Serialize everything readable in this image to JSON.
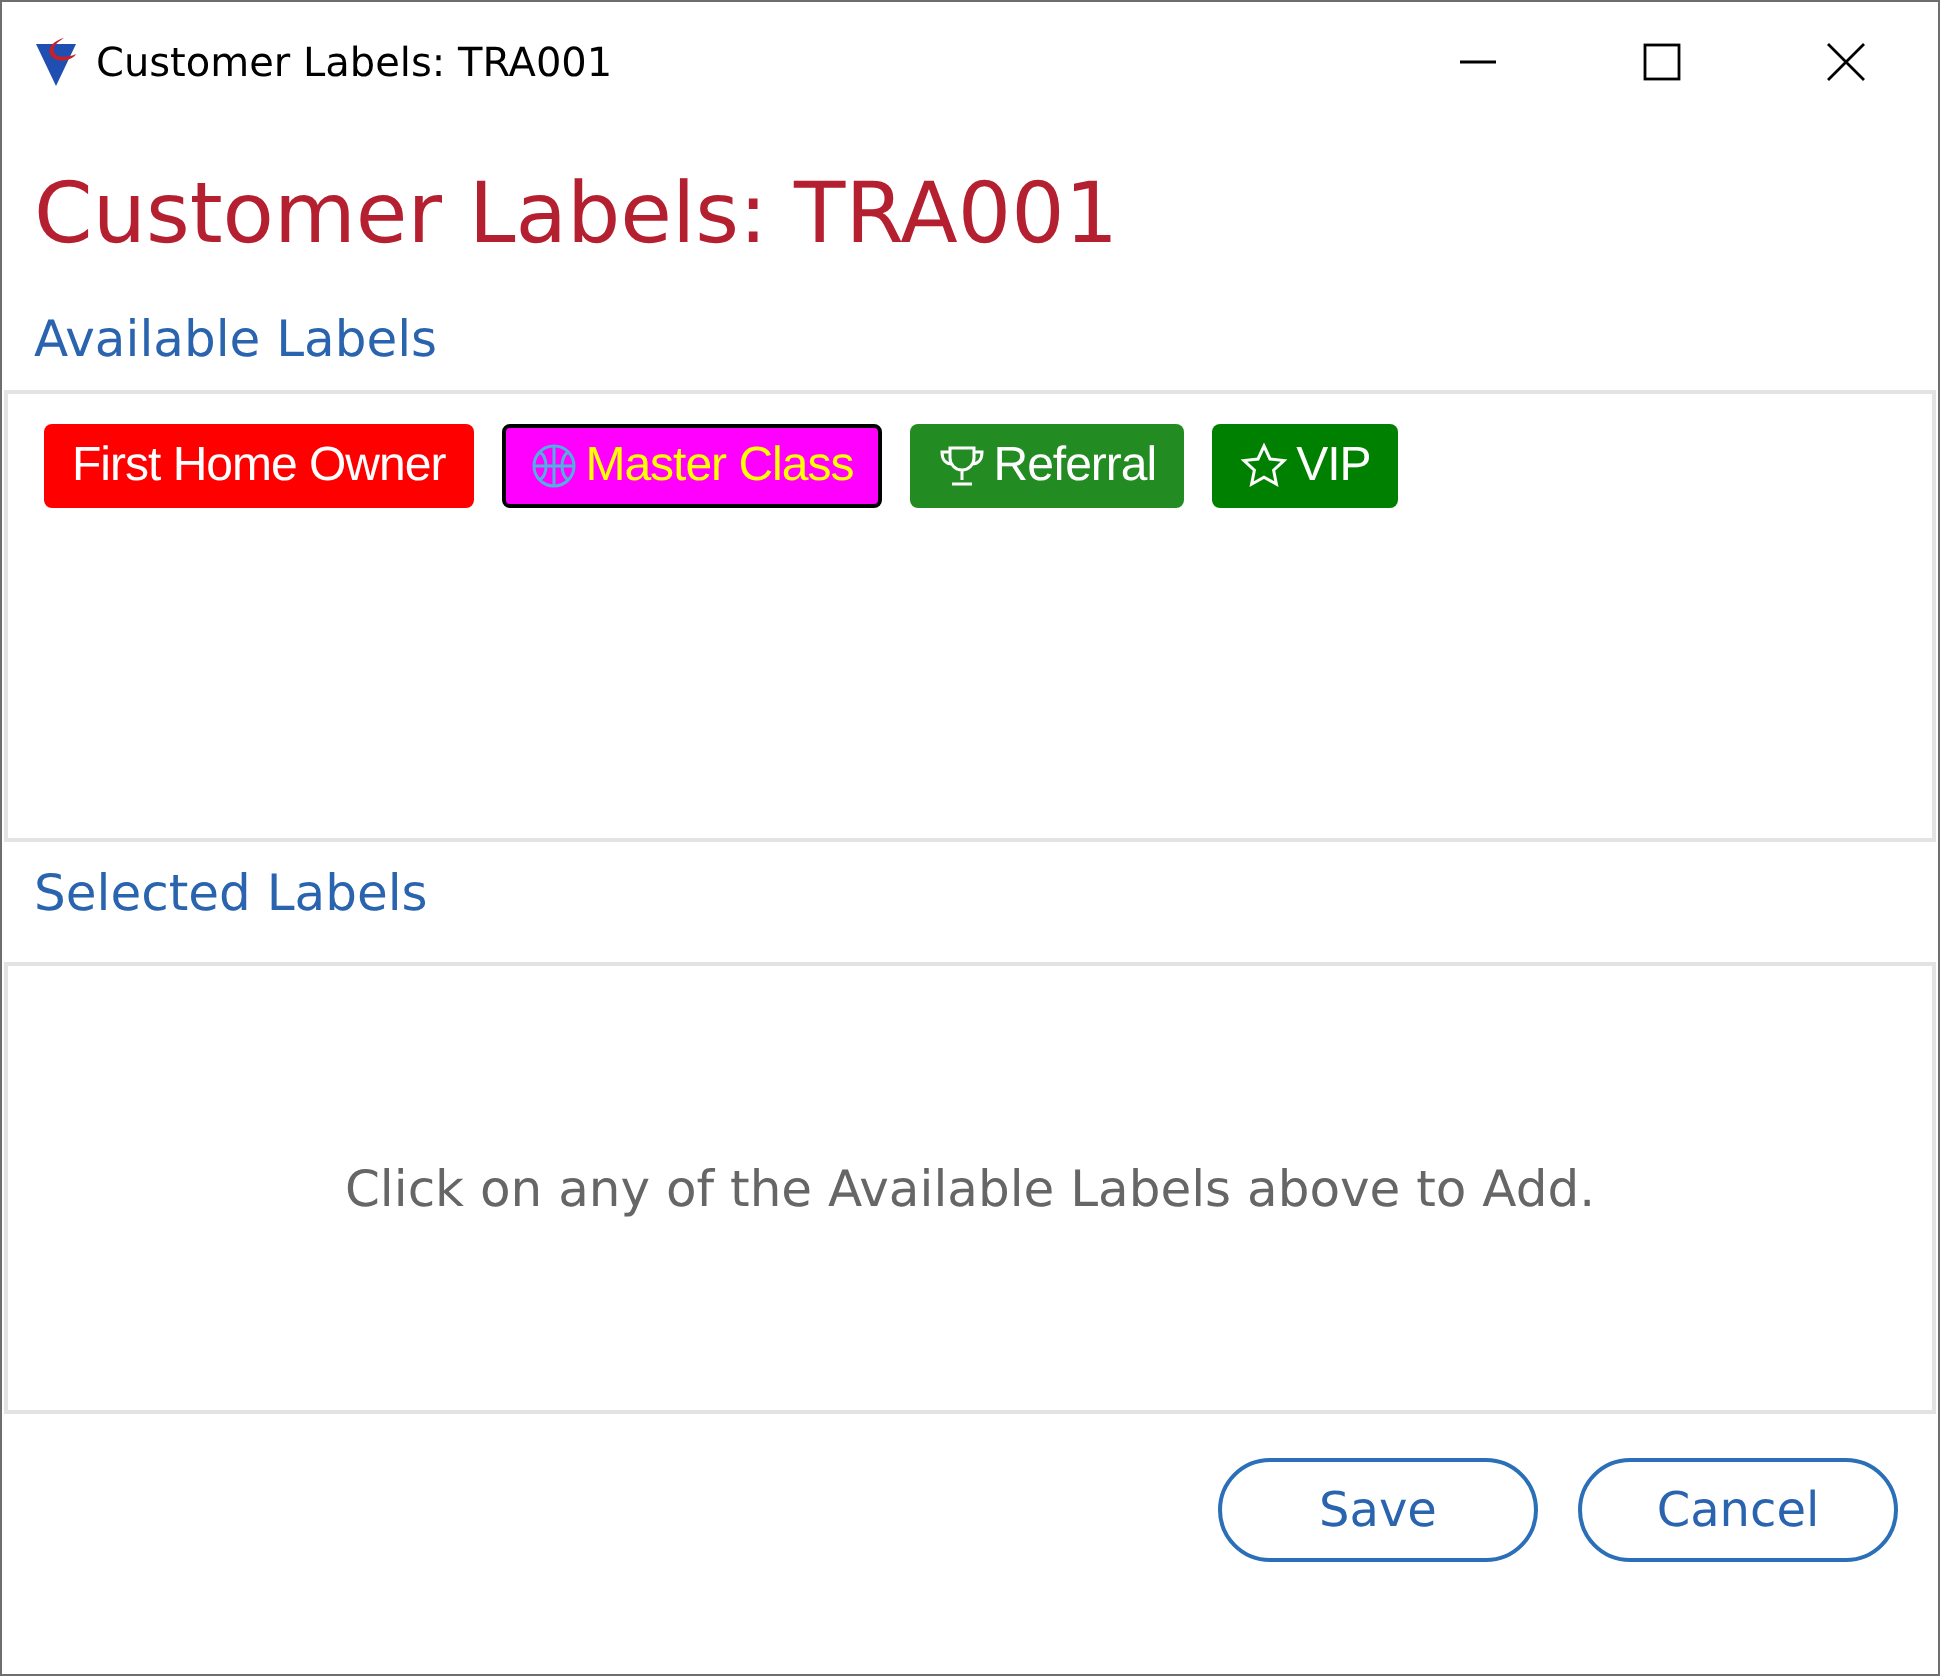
{
  "window": {
    "title": "Customer Labels: TRA001"
  },
  "heading": "Customer Labels: TRA001",
  "available": {
    "title": "Available Labels",
    "labels": [
      {
        "text": "First Home Owner",
        "kind": "plain",
        "color": "#ff0000",
        "focused": false
      },
      {
        "text": "Master Class",
        "kind": "basketball",
        "color": "#ff00ff",
        "focused": true
      },
      {
        "text": "Referral",
        "kind": "trophy",
        "color": "#228b22",
        "focused": false
      },
      {
        "text": "VIP",
        "kind": "star",
        "color": "#008000",
        "focused": false
      }
    ]
  },
  "selected": {
    "title": "Selected Labels",
    "empty_message": "Click on any of the Available Labels above to Add."
  },
  "buttons": [
    "Save",
    "Cancel"
  ]
}
